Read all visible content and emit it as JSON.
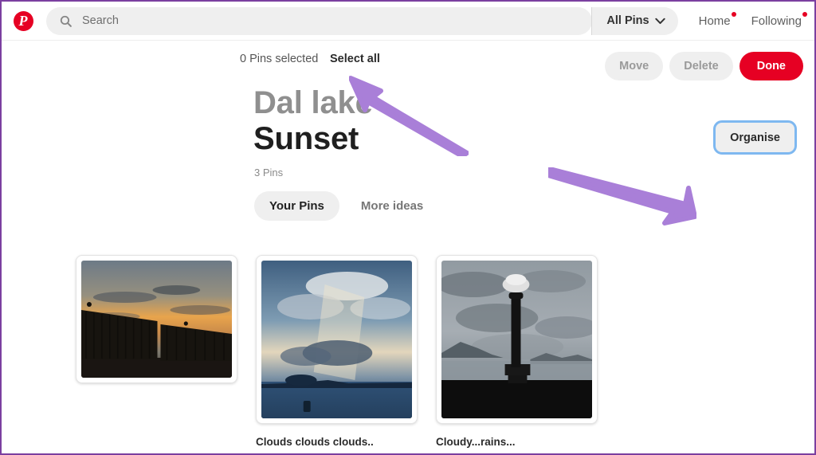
{
  "header": {
    "logo_letter": "P",
    "logo_color": "#e60023",
    "search": {
      "placeholder": "Search",
      "value": "",
      "icon": "search-icon"
    },
    "filter": {
      "label": "All Pins",
      "icon": "chevron-down-icon"
    },
    "nav": [
      {
        "label": "Home",
        "has_notification_dot": true
      },
      {
        "label": "Following",
        "has_notification_dot": true
      }
    ]
  },
  "toolbar": {
    "selection_status": "0 Pins selected",
    "select_all_label": "Select all",
    "move_label": "Move",
    "delete_label": "Delete",
    "done_label": "Done",
    "done_color": "#e60023"
  },
  "board": {
    "title_line1": "Dal lake",
    "title_line2": "Sunset",
    "pin_count": "3 Pins",
    "tabs": [
      {
        "label": "Your Pins",
        "active": true
      },
      {
        "label": "More ideas",
        "active": false
      }
    ],
    "organise_label": "Organise",
    "organise_focus_color": "#7eb8f0"
  },
  "pins": [
    {
      "caption": "",
      "alt": "sunset-behind-iron-fence",
      "has_caption": false
    },
    {
      "caption": "Clouds clouds clouds..",
      "alt": "sunbeams-through-clouds-over-lake",
      "has_caption": true
    },
    {
      "caption": "Cloudy...rains...",
      "alt": "lamp-post-silhouette-against-grey-clouds",
      "has_caption": true
    }
  ],
  "annotations": {
    "arrow_color": "#a97fd8",
    "arrows": [
      {
        "name": "arrow-to-select-all",
        "points_to": "Select all"
      },
      {
        "name": "arrow-to-organise",
        "points_to": "Organise"
      }
    ]
  }
}
